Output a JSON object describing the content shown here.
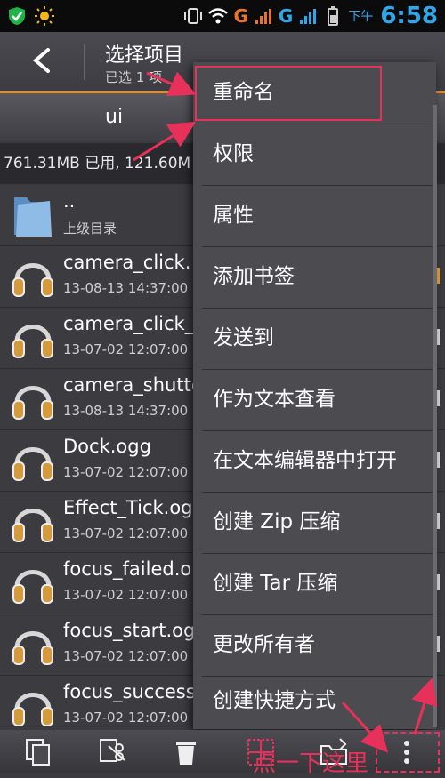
{
  "status_bar": {
    "signal_labels": [
      "G",
      "G"
    ],
    "ampm": "下午",
    "time": "6:58",
    "accent": "#2fa7e8"
  },
  "action_bar": {
    "title": "选择项目",
    "subtitle": "已选 1 项"
  },
  "path_bar": {
    "current_folder": "ui",
    "storage_text": "761.31MB 已用, 121.60M"
  },
  "files": [
    {
      "name": "..",
      "date": "上级目录",
      "icon": "folder-icon"
    },
    {
      "name": "camera_click.",
      "date": "13-08-13 14:37:00",
      "icon": "headphones-icon"
    },
    {
      "name": "camera_click_",
      "date": "13-07-02 12:07:00",
      "icon": "headphones-icon"
    },
    {
      "name": "camera_shutte",
      "date": "13-08-13 14:37:00",
      "icon": "headphones-icon"
    },
    {
      "name": "Dock.ogg",
      "date": "13-07-02 12:07:00",
      "icon": "headphones-icon"
    },
    {
      "name": "Effect_Tick.og",
      "date": "13-07-02 12:07:00",
      "icon": "headphones-icon"
    },
    {
      "name": "focus_failed.o",
      "date": "13-07-02 12:07:00",
      "icon": "headphones-icon"
    },
    {
      "name": "focus_start.og",
      "date": "13-07-02 12:07:00",
      "icon": "headphones-icon"
    },
    {
      "name": "focus_success",
      "date": "13-07-02 12:07:00",
      "icon": "headphones-icon"
    }
  ],
  "menu": {
    "items": [
      {
        "label": "重命名"
      },
      {
        "label": "权限"
      },
      {
        "label": "属性"
      },
      {
        "label": "添加书签"
      },
      {
        "label": "发送到"
      },
      {
        "label": "作为文本查看"
      },
      {
        "label": "在文本编辑器中打开"
      },
      {
        "label": "创建 Zip 压缩"
      },
      {
        "label": "创建 Tar 压缩"
      },
      {
        "label": "更改所有者"
      },
      {
        "label": "创建快捷方式"
      }
    ]
  },
  "toolbar": {
    "buttons": [
      "copy-icon",
      "cut-icon",
      "delete-icon",
      "select-all-icon",
      "move-icon",
      "more-icon"
    ]
  },
  "annotation": {
    "text": "点一下这里",
    "color": "#e8315a"
  }
}
